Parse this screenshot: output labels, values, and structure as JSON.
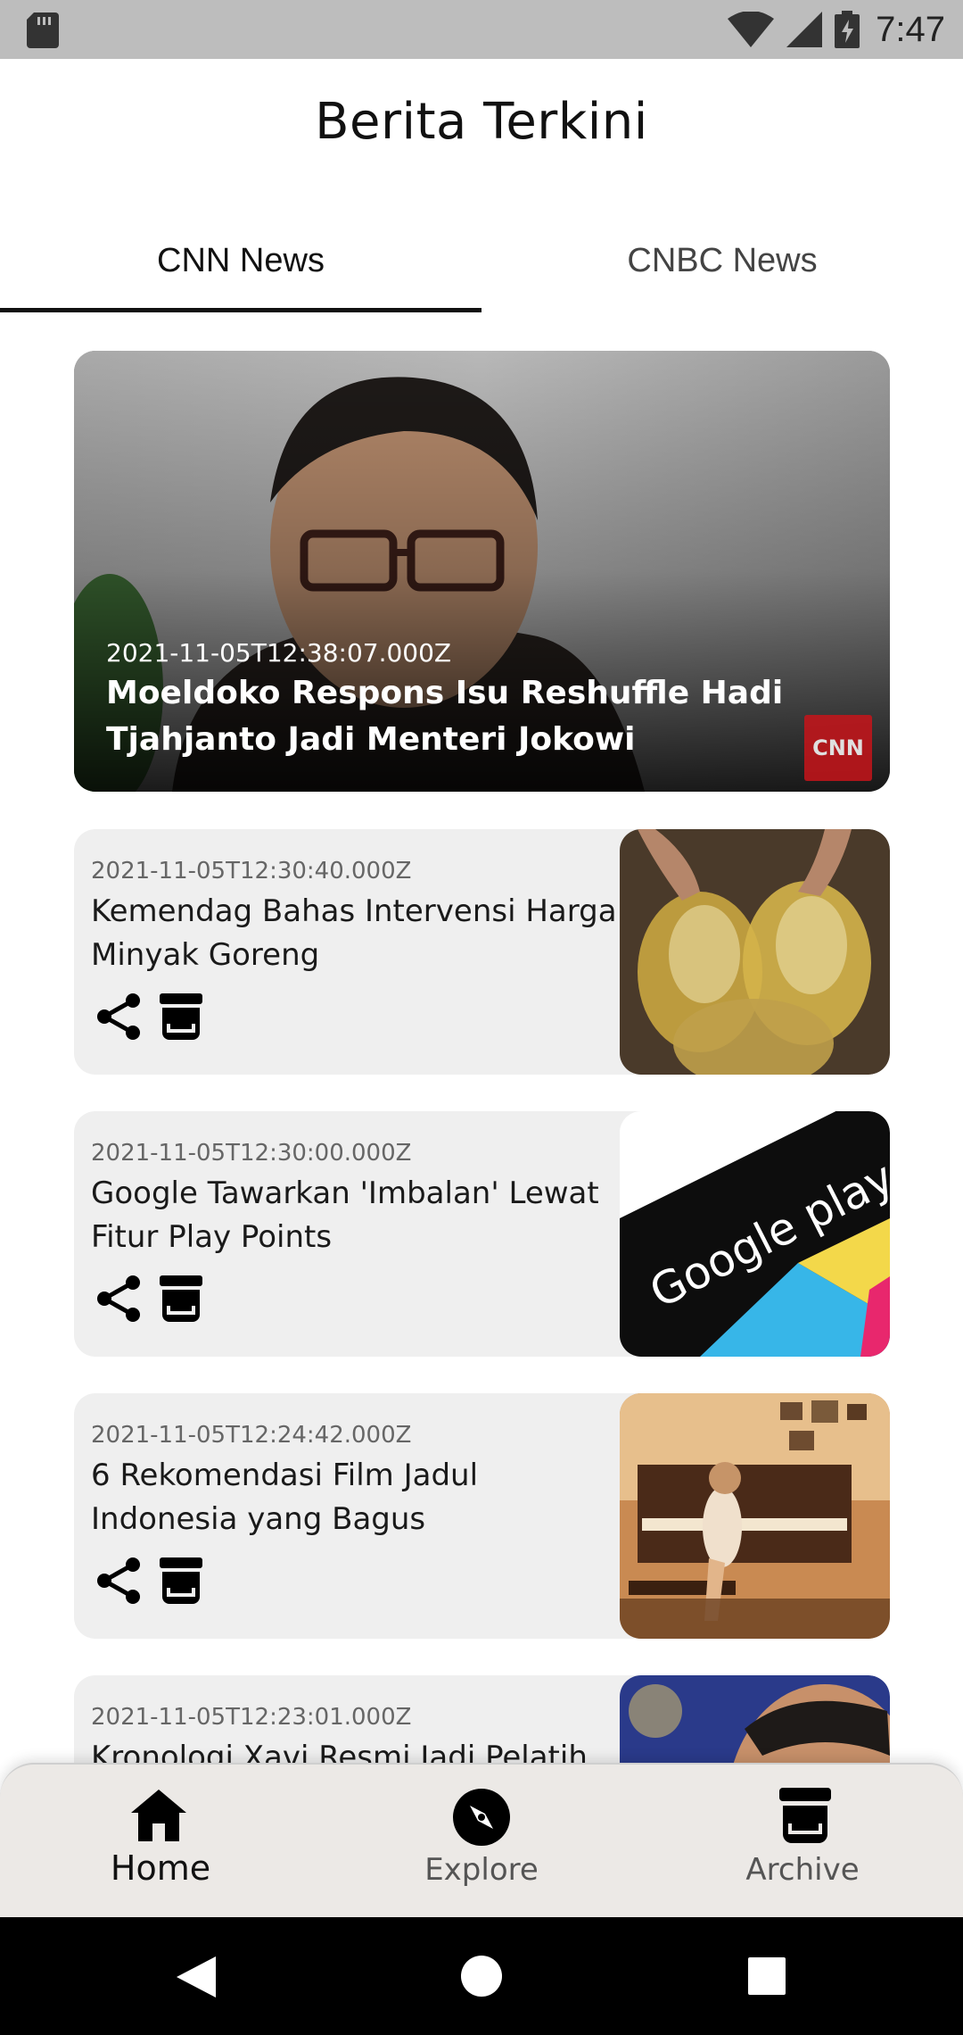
{
  "status_bar": {
    "time": "7:47"
  },
  "header": {
    "title": "Berita Terkini"
  },
  "tabs": [
    {
      "label": "CNN News",
      "active": true
    },
    {
      "label": "CNBC News",
      "active": false
    }
  ],
  "featured": {
    "date": "2021-11-05T12:38:07.000Z",
    "title": "Moeldoko Respons Isu Reshuffle Hadi Tjahjanto Jadi Menteri Jokowi",
    "logo_text": "CNN"
  },
  "articles": [
    {
      "date": "2021-11-05T12:30:40.000Z",
      "title": "Kemendag Bahas Intervensi Harga Minyak Goreng",
      "thumb": "cooking-oil-bags"
    },
    {
      "date": "2021-11-05T12:30:00.000Z",
      "title": "Google Tawarkan 'Imbalan' Lewat Fitur Play Points",
      "thumb": "google-play-card",
      "thumb_text": "Google play"
    },
    {
      "date": "2021-11-05T12:24:42.000Z",
      "title": "6 Rekomendasi Film Jadul Indonesia yang Bagus",
      "thumb": "girl-at-piano"
    },
    {
      "date": "2021-11-05T12:23:01.000Z",
      "title": "Kronologi Xavi Resmi Jadi Pelatih",
      "thumb": "man-portrait"
    }
  ],
  "bottom_nav": [
    {
      "label": "Home",
      "icon": "home-icon",
      "active": true
    },
    {
      "label": "Explore",
      "icon": "compass-icon",
      "active": false
    },
    {
      "label": "Archive",
      "icon": "archive-icon",
      "active": false
    }
  ],
  "colors": {
    "accent": "#111111",
    "card_bg": "#efefef",
    "nav_bg": "#ece9e6",
    "cnn_red": "#c7141a"
  }
}
